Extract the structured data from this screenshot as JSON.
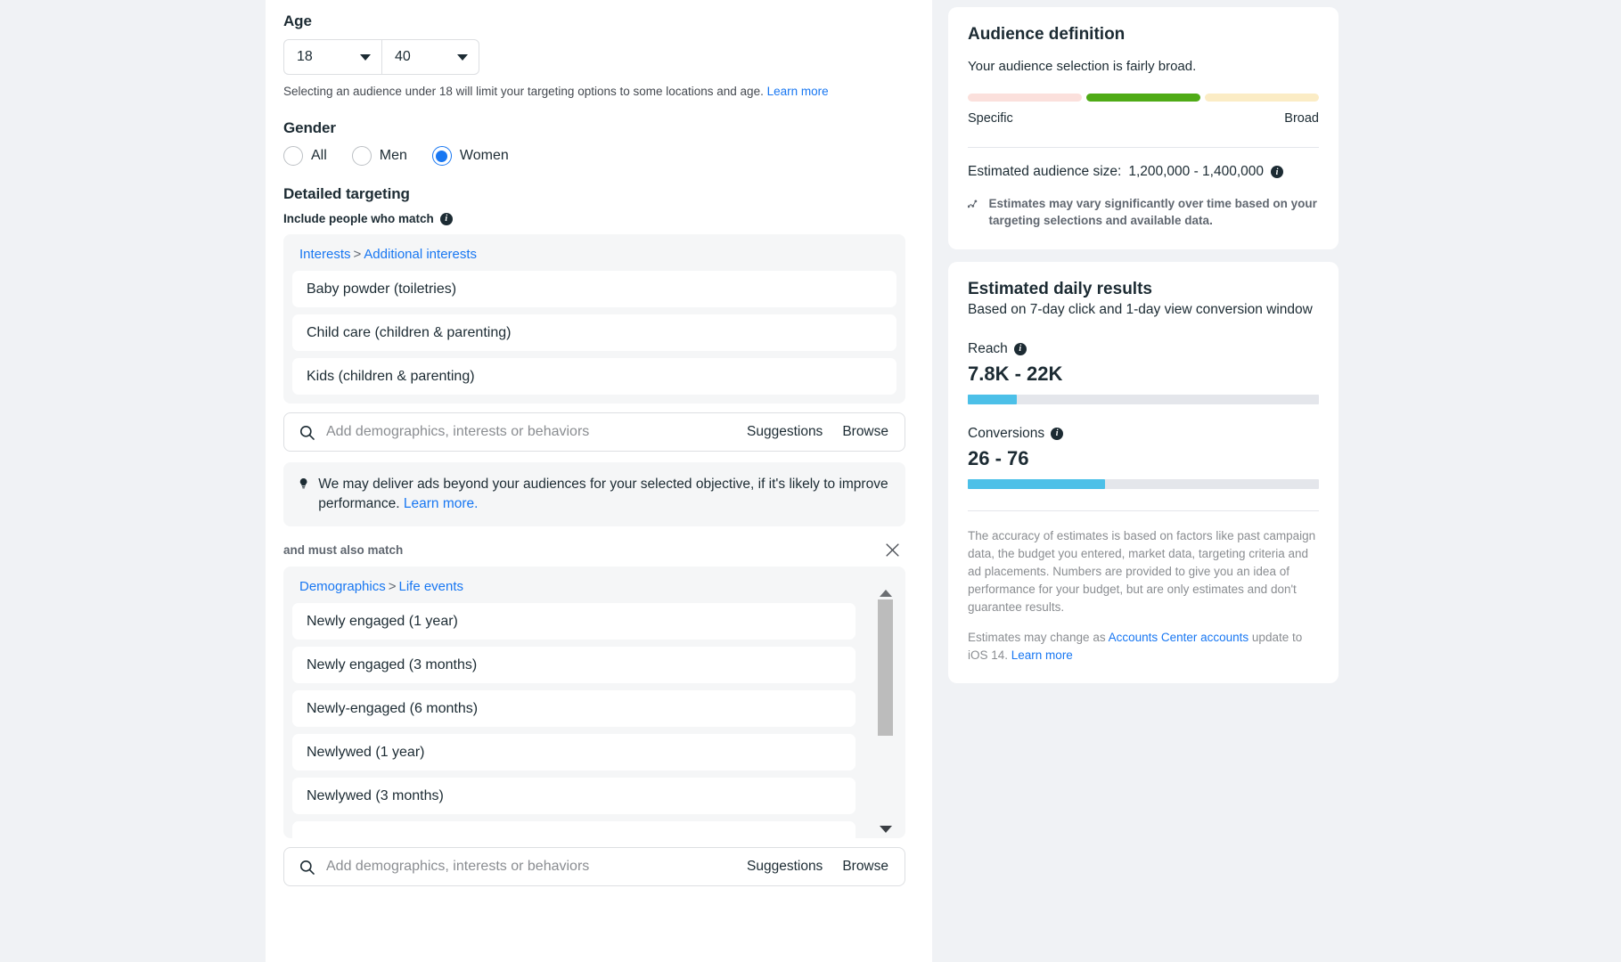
{
  "form": {
    "age": {
      "label": "Age",
      "min": "18",
      "max": "40",
      "hint": "Selecting an audience under 18 will limit your targeting options to some locations and age.",
      "hint_link": "Learn more"
    },
    "gender": {
      "label": "Gender",
      "options": [
        {
          "label": "All",
          "selected": false
        },
        {
          "label": "Men",
          "selected": false
        },
        {
          "label": "Women",
          "selected": true
        }
      ]
    },
    "detailed_targeting": {
      "label": "Detailed targeting",
      "include_label": "Include people who match",
      "include_group": {
        "breadcrumb_root": "Interests",
        "breadcrumb_sep": ">",
        "breadcrumb_leaf": "Additional interests",
        "items": [
          "Baby powder (toiletries)",
          "Child care (children & parenting)",
          "Kids (children & parenting)"
        ]
      },
      "search": {
        "placeholder": "Add demographics, interests or behaviors",
        "suggestions_label": "Suggestions",
        "browse_label": "Browse"
      },
      "tip": {
        "text": "We may deliver ads beyond your audiences for your selected objective, if it's likely to improve performance.",
        "link": "Learn more."
      },
      "also_match_label": "and must also match",
      "also_group": {
        "breadcrumb_root": "Demographics",
        "breadcrumb_sep": ">",
        "breadcrumb_leaf": "Life events",
        "items": [
          "Newly engaged (1 year)",
          "Newly engaged (3 months)",
          "Newly-engaged (6 months)",
          "Newlywed (1 year)",
          "Newlywed (3 months)"
        ]
      },
      "search2": {
        "placeholder": "Add demographics, interests or behaviors",
        "suggestions_label": "Suggestions",
        "browse_label": "Browse"
      }
    }
  },
  "audience_definition": {
    "title": "Audience definition",
    "subtitle": "Your audience selection is fairly broad.",
    "meter_colors": [
      "#fbe0dc",
      "#4fab16",
      "#fbecc5"
    ],
    "scale_left": "Specific",
    "scale_right": "Broad",
    "estimated_size_label": "Estimated audience size:",
    "estimated_size_value": "1,200,000 - 1,400,000",
    "note": "Estimates may vary significantly over time based on your targeting selections and available data."
  },
  "estimated_daily_results": {
    "title": "Estimated daily results",
    "subtitle": "Based on 7-day click and 1-day view conversion window",
    "metrics": [
      {
        "label": "Reach",
        "value": "7.8K - 22K",
        "fill_percent": 14,
        "color": "#4cc0e8"
      },
      {
        "label": "Conversions",
        "value": "26 - 76",
        "fill_percent": 39,
        "color": "#4cc0e8"
      }
    ],
    "disclaimer": "The accuracy of estimates is based on factors like past campaign data, the budget you entered, market data, targeting criteria and ad placements. Numbers are provided to give you an idea of performance for your budget, but are only estimates and don't guarantee results.",
    "ios_note_prefix": "Estimates may change as ",
    "ios_note_link1": "Accounts Center accounts",
    "ios_note_mid": " update to iOS 14. ",
    "ios_note_link2": "Learn more"
  }
}
